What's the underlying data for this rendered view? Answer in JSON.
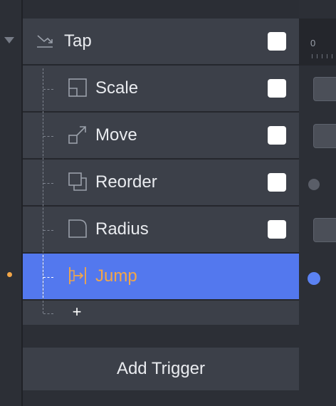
{
  "layers": {
    "root": {
      "label": "Tap",
      "icon": "tap-trigger-icon",
      "checked": false
    },
    "children": [
      {
        "label": "Scale",
        "icon": "scale-icon"
      },
      {
        "label": "Move",
        "icon": "move-icon"
      },
      {
        "label": "Reorder",
        "icon": "reorder-icon"
      },
      {
        "label": "Radius",
        "icon": "radius-icon"
      },
      {
        "label": "Jump",
        "icon": "jump-icon",
        "selected": true
      }
    ],
    "add_symbol": "+"
  },
  "footer": {
    "add_trigger_label": "Add Trigger"
  },
  "timeline": {
    "start_tick": "0"
  },
  "colors": {
    "selected_row": "#5378ee",
    "selected_text": "#f2a648",
    "timeline_dot_active": "#5b82f2",
    "timeline_dot_inactive": "#5a5e68"
  }
}
